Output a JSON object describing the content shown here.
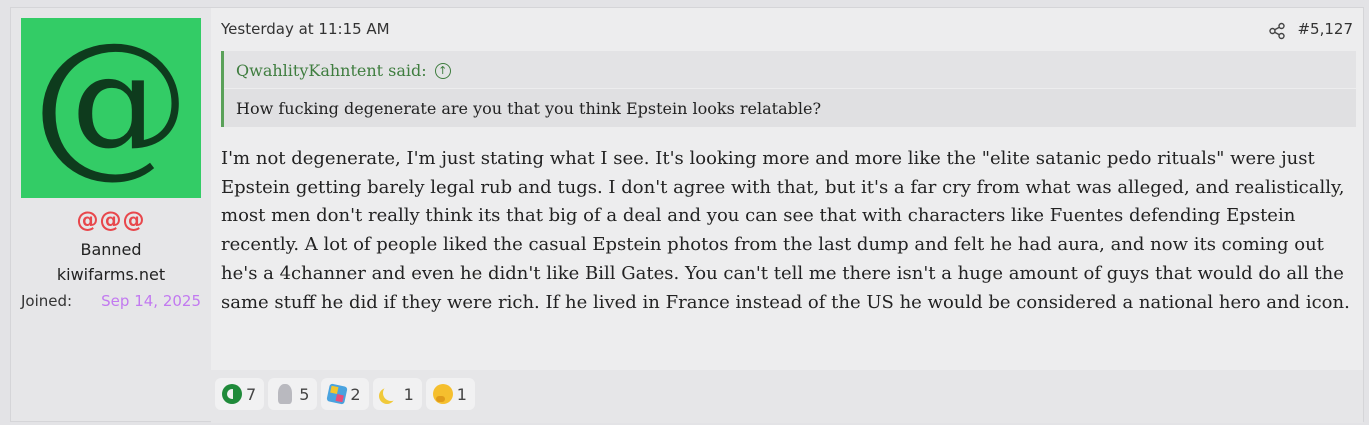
{
  "user": {
    "avatar_char": "@",
    "name": "@@@",
    "title": "Banned",
    "banner": "kiwifarms.net",
    "joined_label": "Joined:",
    "joined_date": "Sep 14, 2025"
  },
  "post": {
    "date": "Yesterday at 11:15 AM",
    "number": "#5,127",
    "quote": {
      "author": "QwahlityKahntent said:",
      "text": "How fucking degenerate are you that you think Epstein looks relatable?"
    },
    "message": "I'm not degenerate, I'm just stating what I see. It's looking more and more like the \"elite satanic pedo rituals\" were just Epstein getting barely legal rub and tugs. I don't agree with that, but it's a far cry from what was alleged, and realistically, most men don't really think its that big of a deal and you can see that with characters like Fuentes defending Epstein recently. A lot of people liked the casual Epstein photos from the last dump and felt he had aura, and now its coming out he's a 4channer and even he didn't like Bill Gates. You can't tell me there isn't a huge amount of guys that would do all the same stuff he did if they were rich. If he lived in France instead of the US he would be considered a national hero and icon."
  },
  "reactions": [
    {
      "icon": "winner-icon",
      "count": "7"
    },
    {
      "icon": "stone-icon",
      "count": "5"
    },
    {
      "icon": "puzzle-icon",
      "count": "2"
    },
    {
      "icon": "moon-icon",
      "count": "1"
    },
    {
      "icon": "thinking-icon",
      "count": "1"
    }
  ],
  "colors": {
    "avatar_bg": "#33cc66",
    "username": "#e8474c",
    "joined_date": "#c27af0",
    "quote_accent": "#5aa159"
  }
}
